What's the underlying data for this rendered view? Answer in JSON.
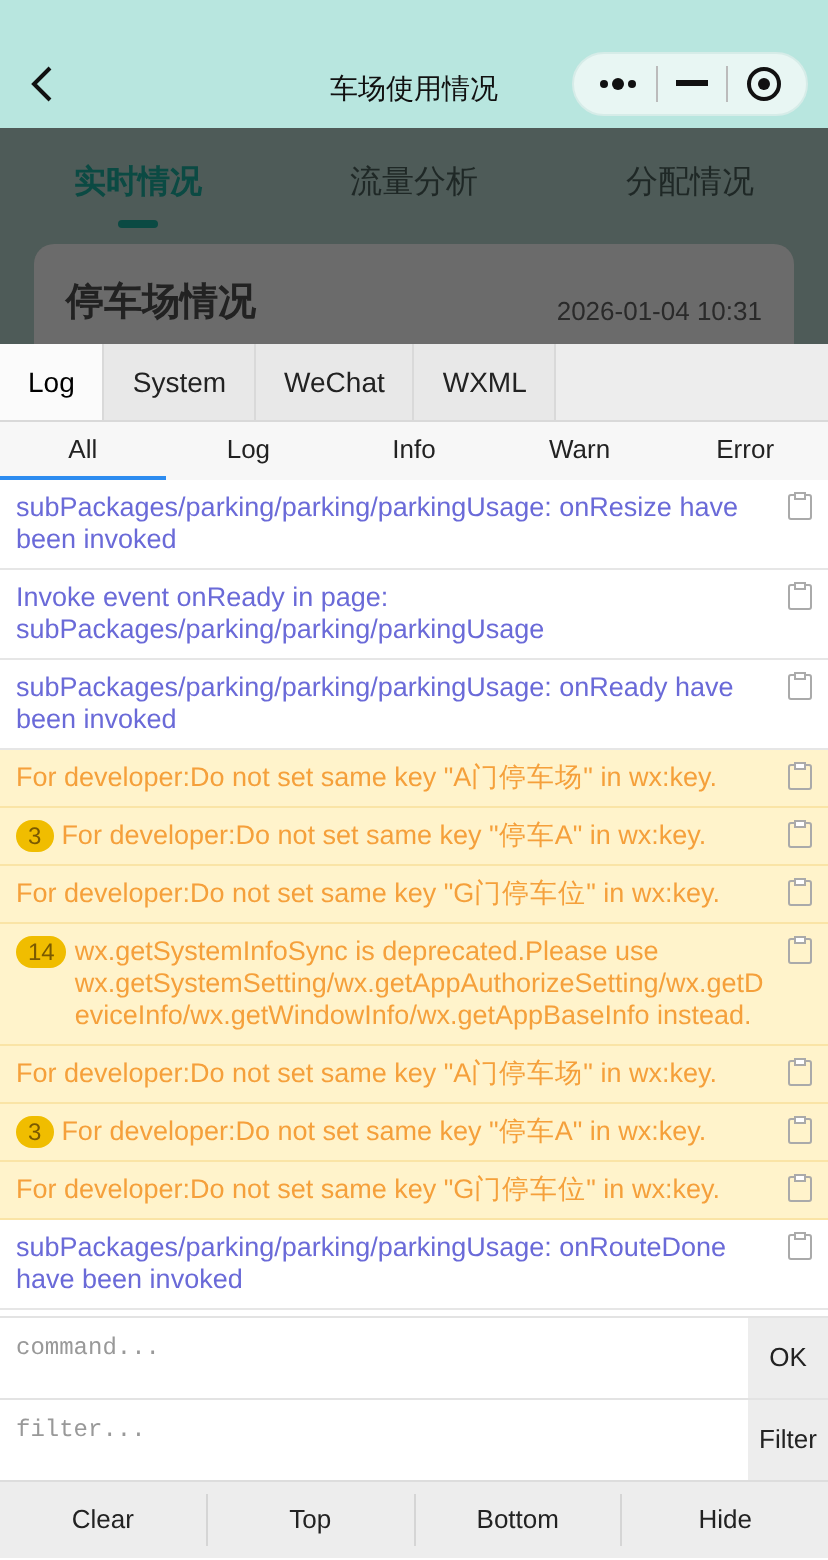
{
  "header": {
    "title": "车场使用情况"
  },
  "page_tabs": [
    {
      "label": "实时情况",
      "selected": true
    },
    {
      "label": "流量分析",
      "selected": false
    },
    {
      "label": "分配情况",
      "selected": false
    }
  ],
  "card": {
    "title": "停车场情况",
    "time": "2026-01-04 10:31"
  },
  "console_tabs": [
    {
      "label": "Log",
      "selected": true
    },
    {
      "label": "System",
      "selected": false
    },
    {
      "label": "WeChat",
      "selected": false
    },
    {
      "label": "WXML",
      "selected": false
    }
  ],
  "level_tabs": [
    {
      "label": "All",
      "selected": true
    },
    {
      "label": "Log",
      "selected": false
    },
    {
      "label": "Info",
      "selected": false
    },
    {
      "label": "Warn",
      "selected": false
    },
    {
      "label": "Error",
      "selected": false
    }
  ],
  "logs": [
    {
      "kind": "log",
      "text": "subPackages/parking/parking/parkingUsage: onResize have been invoked"
    },
    {
      "kind": "log",
      "text": "Invoke event onReady in page: subPackages/parking/parking/parkingUsage"
    },
    {
      "kind": "log",
      "text": "subPackages/parking/parking/parkingUsage: onReady have been invoked"
    },
    {
      "kind": "warn",
      "text": "For developer:Do not set same key \"A门停车场\" in wx:key."
    },
    {
      "kind": "warn",
      "count": "3",
      "text": "For developer:Do not set same key \"停车A\" in wx:key."
    },
    {
      "kind": "warn",
      "text": "For developer:Do not set same key \"G门停车位\" in wx:key."
    },
    {
      "kind": "warn",
      "count": "14",
      "text": "wx.getSystemInfoSync is deprecated.Please use wx.getSystemSetting/wx.getAppAuthorizeSetting/wx.getDeviceInfo/wx.getWindowInfo/wx.getAppBaseInfo instead."
    },
    {
      "kind": "warn",
      "text": "For developer:Do not set same key \"A门停车场\" in wx:key."
    },
    {
      "kind": "warn",
      "count": "3",
      "text": "For developer:Do not set same key \"停车A\" in wx:key."
    },
    {
      "kind": "warn",
      "text": "For developer:Do not set same key \"G门停车位\" in wx:key."
    },
    {
      "kind": "log",
      "text": "subPackages/parking/parking/parkingUsage: onRouteDone have been invoked"
    }
  ],
  "command": {
    "placeholder": "command...",
    "button": "OK"
  },
  "filter": {
    "placeholder": "filter...",
    "button": "Filter"
  },
  "footer_buttons": [
    "Clear",
    "Top",
    "Bottom",
    "Hide"
  ]
}
